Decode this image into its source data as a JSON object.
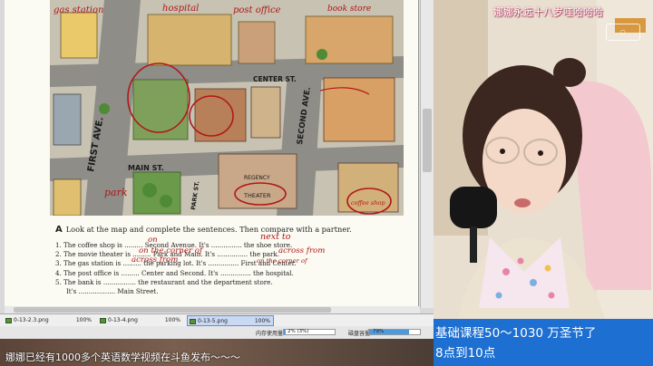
{
  "stream": {
    "cam_title": "娜娜永远十八岁哇哈哈哈",
    "promo_line1": "基础课程50～1030   万圣节了",
    "promo_line2": "8点到10点",
    "bottom_text": "娜娜已经有1000多个英语数学视频在斗鱼发布～～～"
  },
  "map": {
    "labels": {
      "gas_station": "gas station",
      "hospital": "hospital",
      "post_office": "post office",
      "book_store": "book store",
      "first_ave": "FIRST AVE.",
      "main_st": "MAIN ST.",
      "center_st": "CENTER ST.",
      "second_ave": "SECOND AVE.",
      "park_st": "PARK ST.",
      "regency": "REGENCY",
      "theater": "THEATER",
      "park": "park",
      "coffee_shop": "coffee shop"
    }
  },
  "exercise": {
    "letter": "A",
    "heading": "Look at the map and complete the sentences. Then compare with a partner.",
    "lines": [
      "1. The coffee shop is ......... Second Avenue. It's ............... the shoe store.",
      "2. The movie theater is ......... Park and Main. It's ............... the park.",
      "3. The gas station is ......... the parking lot. It's ............... First and Center.",
      "4. The post office is ......... Center and Second. It's ............... the hospital.",
      "5. The bank is ................ the restaurant and the department store.",
      "It's .................. Main Street."
    ],
    "handwriting": {
      "on": "on",
      "next_to": "next to",
      "on_the_corner_of": "on the corner of",
      "across_from": "across from",
      "across_from_2": "across from",
      "on_the_corner_of_2": "on the corner of"
    }
  },
  "thumbnails": [
    {
      "name": "0-13-2.3.png",
      "zoom": "100%"
    },
    {
      "name": "0-13-4.png",
      "zoom": "100%"
    },
    {
      "name": "0-13-5.png",
      "zoom": "100%"
    }
  ],
  "status": {
    "memory_label": "内存使用量",
    "memory_value": "2% (3%)",
    "memory_fraction": 0.03,
    "disk_label": "磁盘容量",
    "disk_value": "79%",
    "disk_fraction": 0.79
  },
  "colors": {
    "promo_bg": "#1d6fd1",
    "handwriting": "#b01818",
    "active_tab": "#c9d9f3"
  }
}
